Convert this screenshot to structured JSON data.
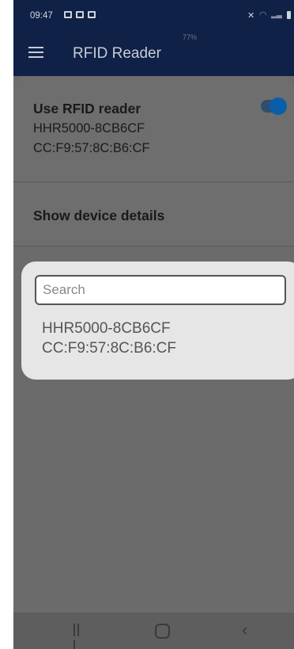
{
  "status_bar": {
    "time": "09:47",
    "battery_percent": "77%"
  },
  "app_bar": {
    "title": "RFID Reader",
    "menu_icon": "hamburger-menu-icon"
  },
  "settings": {
    "use_reader_title": "Use RFID reader",
    "device_name": "HHR5000-8CB6CF",
    "device_address": "CC:F9:57:8C:B6:CF",
    "toggle_on": true,
    "show_details_label": "Show device details"
  },
  "dialog": {
    "search_placeholder": "Search",
    "devices": [
      {
        "name": "HHR5000-8CB6CF",
        "address": "CC:F9:57:8C:B6:CF"
      }
    ]
  },
  "nav_bar": {
    "recent_icon": "recent-apps-icon",
    "home_icon": "home-icon",
    "back_icon": "back-icon"
  }
}
